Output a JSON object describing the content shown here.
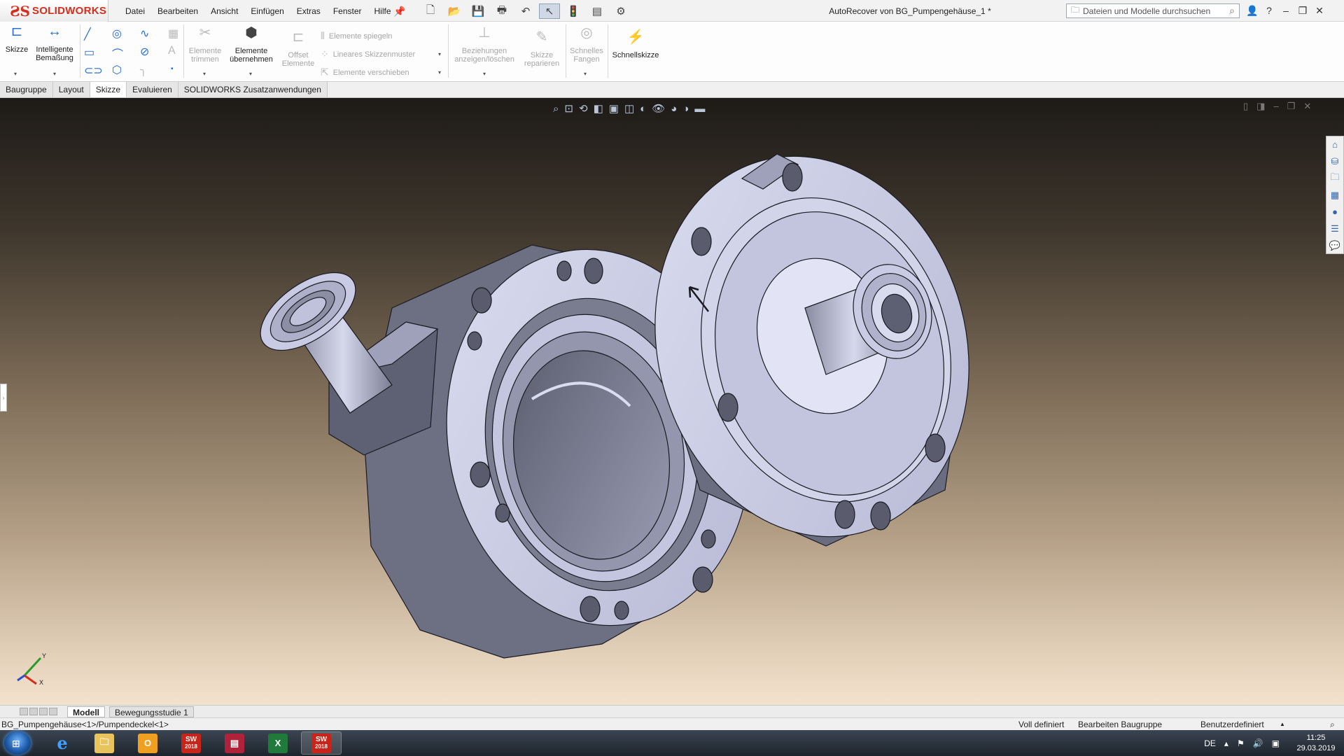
{
  "app": {
    "logo_ds": "ƧS",
    "logo_text": "SOLIDWORKS",
    "window_title": "AutoRecover von BG_Pumpengehäuse_1 *"
  },
  "menu": [
    "Datei",
    "Bearbeiten",
    "Ansicht",
    "Einfügen",
    "Extras",
    "Fenster",
    "Hilfe"
  ],
  "search": {
    "placeholder": "Dateien und Modelle durchsuchen"
  },
  "commands": {
    "skizze": "Skizze",
    "bemassung_1": "Intelligente",
    "bemassung_2": "Bemaßung",
    "trimmen_1": "Elemente",
    "trimmen_2": "trimmen",
    "uebernehmen_1": "Elemente",
    "uebernehmen_2": "übernehmen",
    "offset_1": "Offset",
    "offset_2": "Elemente",
    "spiegeln": "Elemente spiegeln",
    "muster": "Lineares Skizzenmuster",
    "verschieben": "Elemente verschieben",
    "beziehungen_1": "Beziehungen",
    "beziehungen_2": "anzeigen/löschen",
    "reparieren_1": "Skizze",
    "reparieren_2": "reparieren",
    "fangen_1": "Schnelles",
    "fangen_2": "Fangen",
    "schnellskizze": "Schnellskizze"
  },
  "tabs": [
    "Baugruppe",
    "Layout",
    "Skizze",
    "Evaluieren",
    "SOLIDWORKS Zusatzanwendungen"
  ],
  "active_tab": "Skizze",
  "model_tabs": [
    "Modell",
    "Bewegungsstudie 1"
  ],
  "status": {
    "path": "BG_Pumpengehäuse<1>/Pumpendeckel<1>",
    "defined": "Voll definiert",
    "mode": "Bearbeiten Baugruppe",
    "units": "Benutzerdefiniert"
  },
  "triad": {
    "y": "Y",
    "x": "X"
  },
  "taskbar": {
    "sw_badge_1": "2018",
    "sw_badge_2": "2018",
    "lang": "DE",
    "time": "11:25",
    "date": "29.03.2019"
  },
  "colors": {
    "brand_red": "#d42e1e",
    "accent_blue": "#2a6fd0",
    "part_face": "#c9cbe4",
    "part_shadow": "#6a6c80"
  }
}
